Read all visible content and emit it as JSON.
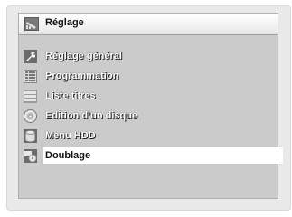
{
  "header": {
    "title": "Réglage",
    "icon": "settings-menu-icon"
  },
  "menu": {
    "items": [
      {
        "label": "Réglage général",
        "icon": "wrench-icon"
      },
      {
        "label": "Programmation",
        "icon": "schedule-grid-icon"
      },
      {
        "label": "Liste titres",
        "icon": "title-list-icon"
      },
      {
        "label": "Edition d’un disque",
        "icon": "disc-icon"
      },
      {
        "label": "Menu HDD",
        "icon": "hdd-icon"
      },
      {
        "label": "Doublage",
        "icon": "dubbing-icon"
      }
    ],
    "selected_index": 5
  },
  "colors": {
    "panel": "#cbcbcb",
    "highlight": "#ffffff"
  }
}
